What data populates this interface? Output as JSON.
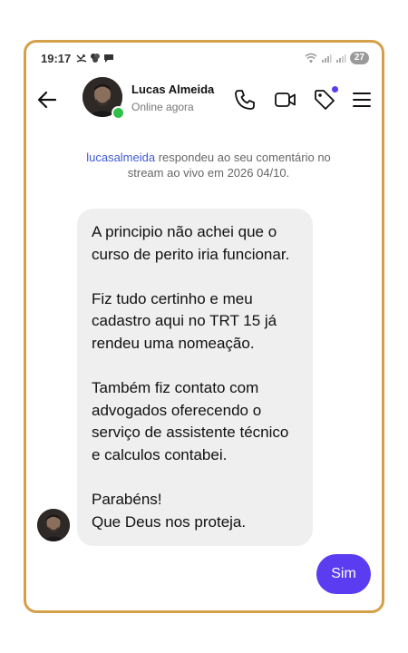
{
  "status_bar": {
    "time": "19:17",
    "battery": "27"
  },
  "contact": {
    "name": "Lucas Almeida",
    "status": "Online agora"
  },
  "notice": {
    "username": "lucasalmeida",
    "text": " respondeu ao seu comentário no stream ao vivo em 2026 04/10."
  },
  "message": {
    "paragraphs": [
      "A principio não achei que o curso de perito iria funcionar.",
      "Fiz tudo certinho e meu cadastro aqui no TRT 15 já rendeu uma nomeação.",
      "Também fiz contato com advogados oferecendo o serviço de assistente técnico e calculos contabei.",
      "Parabéns!\nQue Deus nos proteja."
    ]
  },
  "reply": {
    "label": "Sim"
  },
  "icons": {
    "back": "arrow-left-icon",
    "call": "phone-icon",
    "video": "video-camera-icon",
    "tag": "tag-icon",
    "menu": "hamburger-menu-icon"
  },
  "colors": {
    "accent": "#5B3CF0",
    "frame": "#D4A04A",
    "online": "#2FBF4A",
    "link": "#3F5BD8",
    "bubble": "#EFEFEF"
  }
}
